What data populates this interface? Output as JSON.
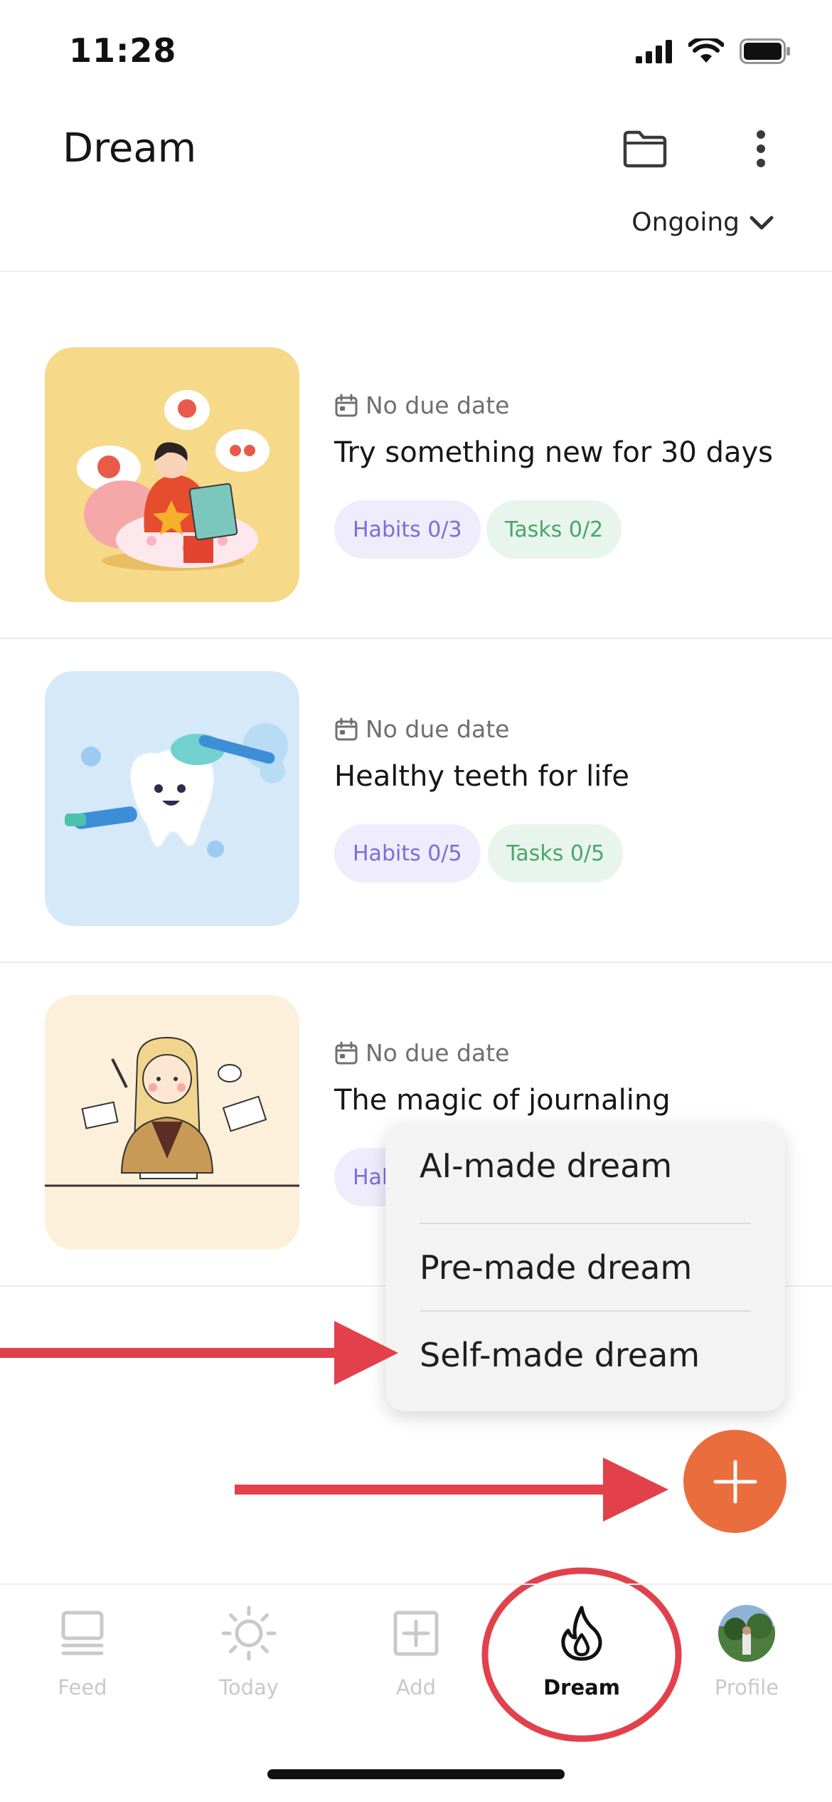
{
  "status_bar": {
    "time": "11:28"
  },
  "header": {
    "title": "Dream",
    "filter_label": "Ongoing"
  },
  "dreams": [
    {
      "due": "No due date",
      "title": "Try something new for 30 days",
      "habits": "Habits 0/3",
      "tasks": "Tasks 0/2"
    },
    {
      "due": "No due date",
      "title": "Healthy teeth for life",
      "habits": "Habits 0/5",
      "tasks": "Tasks 0/5"
    },
    {
      "due": "No due date",
      "title": "The magic of journaling",
      "habits": "Hab"
    }
  ],
  "menu": {
    "items": [
      {
        "label": "AI-made dream"
      },
      {
        "label": "Pre-made dream"
      },
      {
        "label": "Self-made dream"
      }
    ]
  },
  "nav": {
    "items": [
      {
        "label": "Feed",
        "icon": "feed-icon"
      },
      {
        "label": "Today",
        "icon": "sun-icon"
      },
      {
        "label": "Add",
        "icon": "add-square-icon"
      },
      {
        "label": "Dream",
        "icon": "flame-icon"
      },
      {
        "label": "Profile",
        "icon": "avatar"
      }
    ],
    "active": "Dream"
  },
  "colors": {
    "accent": "#ea6d3d",
    "annotation_red": "#e2414b",
    "habits_text": "#7d6cd8",
    "habits_bg": "#efedfb",
    "tasks_text": "#4aa56c",
    "tasks_bg": "#e8f5ec"
  }
}
